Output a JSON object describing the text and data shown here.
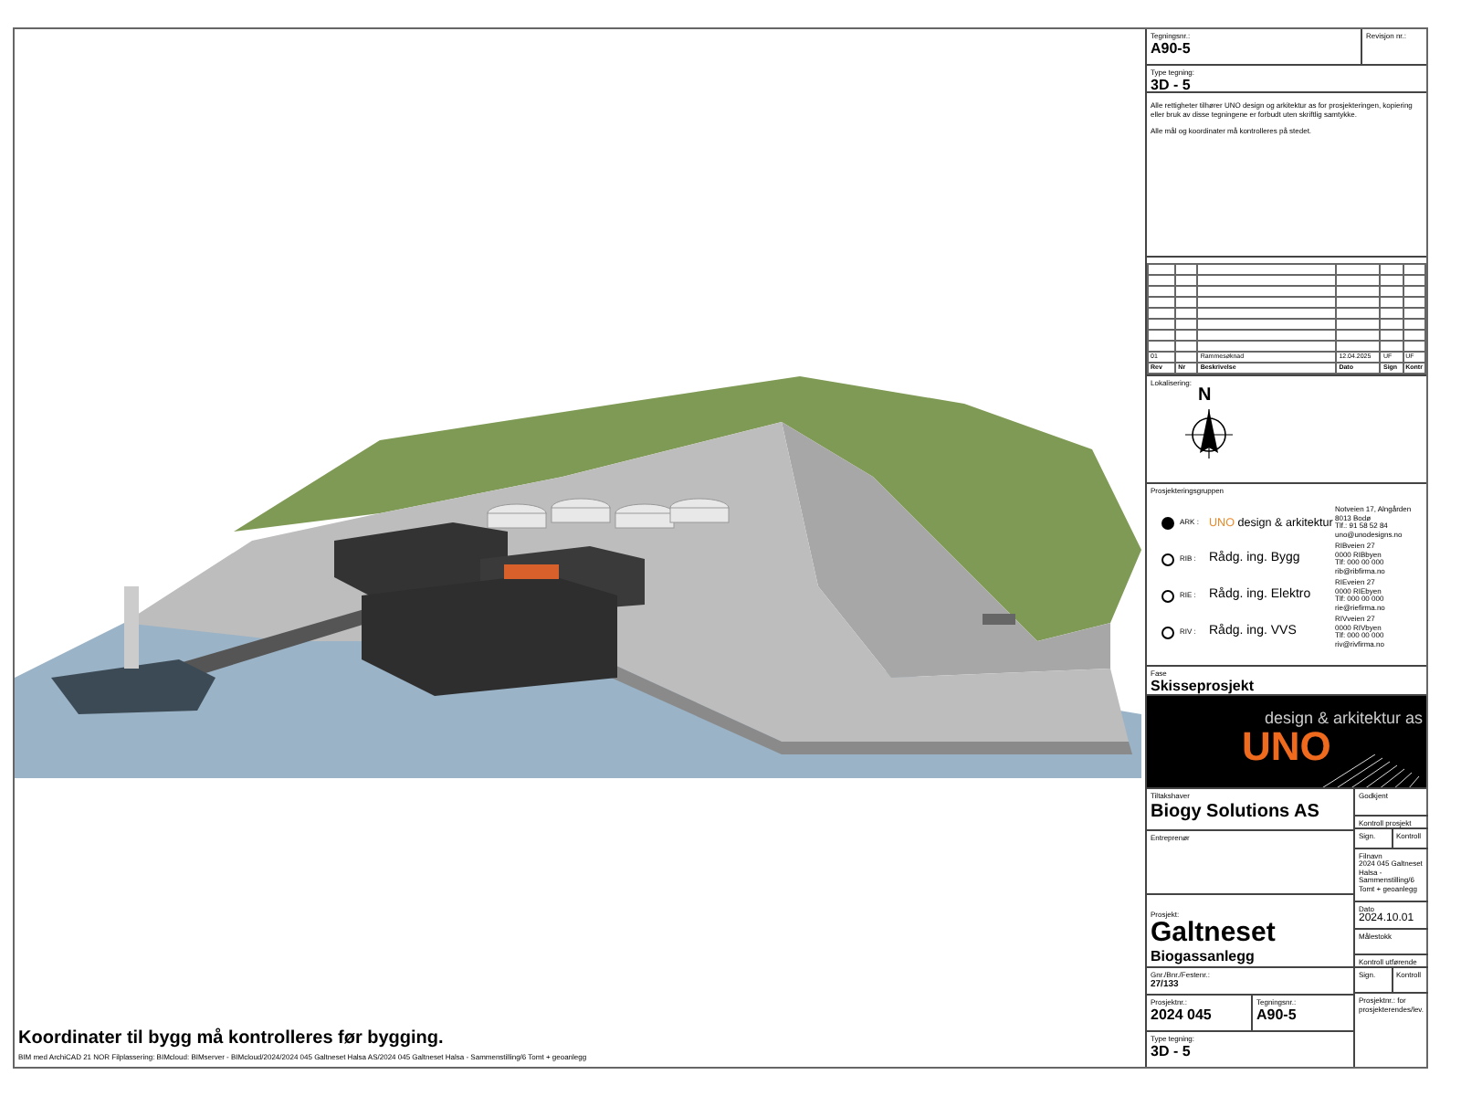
{
  "title_block": {
    "drawing_number": {
      "label": "Tegningsnr.:",
      "value": "A90-5"
    },
    "revision_number": {
      "label": "Revisjon nr.:"
    },
    "drawing_type": {
      "label": "Type tegning:",
      "value": "3D - 5"
    },
    "notes": [
      "Alle rettigheter tilhører UNO design og arkitektur as for prosjekteringen, kopiering eller bruk av disse tegningene er forbudt uten skriftlig samtykke.",
      "Alle mål og koordinater må kontrolleres på stedet."
    ],
    "revisions": {
      "rows": [
        [
          "01",
          "",
          "Rammesøknad",
          "12.04.2025",
          "UF",
          "UF"
        ]
      ],
      "label_row": [
        "Rev",
        "Nr",
        "Beskrivelse",
        "Dato",
        "Sign",
        "Kontr"
      ]
    },
    "location": {
      "label": "Lokalisering:",
      "north": "N"
    },
    "design_team": {
      "label": "Prosjekteringsgruppen",
      "members": [
        {
          "code": "ARK :",
          "brand": "UNO",
          "name": "design & arkitektur",
          "selected": true,
          "address": [
            "Notveien 17, Alngården",
            "8013 Bodø",
            "Tlf.: 91 58 52 84",
            "uno@unodesigns.no"
          ]
        },
        {
          "code": "RIB :",
          "name": "Rådg. ing. Bygg",
          "selected": false,
          "address": [
            "RIBveien 27",
            "0000 RIBbyen",
            "Tlf: 000 00 000",
            "rib@ribfirma.no"
          ]
        },
        {
          "code": "RIE :",
          "name": "Rådg. ing. Elektro",
          "selected": false,
          "address": [
            "RIEveien 27",
            "0000 RIEbyen",
            "Tlf: 000 00 000",
            "rie@riefirma.no"
          ]
        },
        {
          "code": "RIV :",
          "name": "Rådg. ing. VVS",
          "selected": false,
          "address": [
            "RIVveien 27",
            "0000 RIVbyen",
            "Tlf: 000 00 000",
            "riv@rivfirma.no"
          ]
        }
      ]
    },
    "phase": {
      "label": "Fase",
      "value": "Skisseprosjekt"
    },
    "logo": {
      "tagline": "design & arkitektur as",
      "brand": "UNO"
    },
    "client": {
      "label": "Tiltakshaver",
      "value": "Biogy Solutions AS"
    },
    "contractor": {
      "label": "Entreprenør"
    },
    "project": {
      "label": "Prosjekt:",
      "name": "Galtneset",
      "subtitle": "Biogassanlegg"
    },
    "property": {
      "label": "Gnr./Bnr./Festenr.:",
      "value": "27/133"
    },
    "project_number": {
      "label": "Prosjektnr.:",
      "value": "2024 045"
    },
    "drawing_number_bottom": {
      "label": "Tegningsnr.:",
      "value": "A90-5"
    },
    "drawing_type_bottom": {
      "label": "Type tegning:",
      "value": "3D - 5"
    },
    "approved": {
      "label": "Godkjent"
    },
    "project_control": {
      "label": "Kontroll prosjekt",
      "sign": "Sign.",
      "control": "Kontroll"
    },
    "file_name": {
      "label": "Filnavn",
      "value": "2024 045 Galtneset Halsa - Sammenstilling/6 Tomt + geoanlegg"
    },
    "date": {
      "label": "Dato",
      "value": "2024.10.01"
    },
    "scale": {
      "label": "Målestokk"
    },
    "execution_control": {
      "label": "Kontroll utførende",
      "sign": "Sign.",
      "control": "Kontroll"
    },
    "designer_project_number": {
      "label": "Prosjektnr.: for prosjekterendes/lev."
    }
  },
  "footer": {
    "note": "Koordinater til bygg må kontrolleres før bygging.",
    "file_path": "BIM med ArchiCAD 21 NOR    Filplassering: BIMcloud: BIMserver - BIMcloud/2024/2024 045 Galtneset Halsa AS/2024 045 Galtneset Halsa - Sammenstilling/6 Tomt + geoanlegg"
  }
}
